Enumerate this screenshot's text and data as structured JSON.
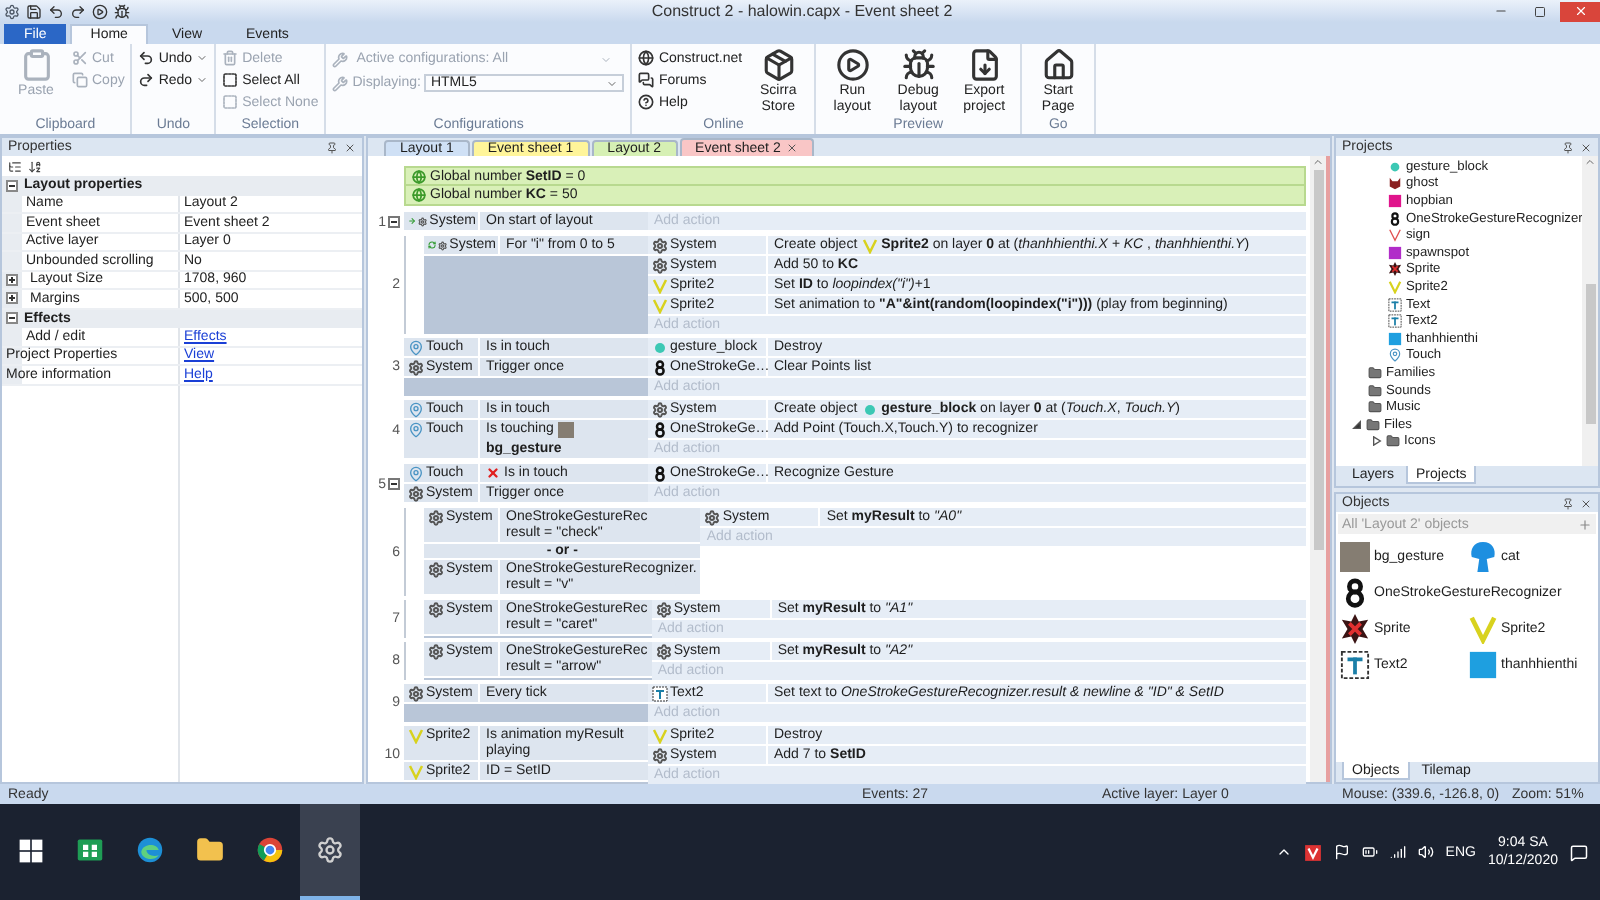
{
  "title_bar": {
    "title": "Construct 2 - halowin.capx - Event sheet 2"
  },
  "ribbon": {
    "tabs": [
      {
        "label": "File",
        "kind": "menu",
        "selected": false
      },
      {
        "label": "Home",
        "kind": "tab",
        "selected": true
      },
      {
        "label": "View",
        "kind": "tab",
        "selected": false
      },
      {
        "label": "Events",
        "kind": "tab",
        "selected": false
      }
    ],
    "groups": [
      {
        "label": "Clipboard",
        "items": [
          {
            "kind": "large",
            "label": "Paste",
            "disabled": true
          },
          {
            "kind": "small",
            "label": "Cut",
            "disabled": true
          },
          {
            "kind": "small",
            "label": "Copy",
            "disabled": true
          }
        ]
      },
      {
        "label": "Undo",
        "items": [
          {
            "kind": "split",
            "label": "Undo",
            "disabled": false
          },
          {
            "kind": "split",
            "label": "Redo",
            "disabled": false
          }
        ]
      },
      {
        "label": "Selection",
        "items": [
          {
            "kind": "small",
            "label": "Delete",
            "disabled": true
          },
          {
            "kind": "small",
            "label": "Select All",
            "disabled": false
          },
          {
            "kind": "small",
            "label": "Select None",
            "disabled": true
          }
        ]
      },
      {
        "label": "Configurations",
        "items": [
          {
            "kind": "combo",
            "label": "Active configurations: All",
            "disabled": true
          },
          {
            "kind": "combo",
            "label": "Displaying:",
            "value": "HTML5",
            "disabled": true
          }
        ]
      },
      {
        "label": "Online",
        "items": [
          {
            "kind": "small",
            "label": "Construct.net",
            "disabled": false
          },
          {
            "kind": "small",
            "label": "Forums",
            "disabled": false
          },
          {
            "kind": "small",
            "label": "Help",
            "disabled": false
          },
          {
            "kind": "large",
            "label": "Scirra Store",
            "disabled": false
          }
        ]
      },
      {
        "label": "Preview",
        "items": [
          {
            "kind": "large",
            "label": "Run layout",
            "disabled": false
          },
          {
            "kind": "large",
            "label": "Debug layout",
            "disabled": false
          },
          {
            "kind": "large",
            "label": "Export project",
            "disabled": false
          }
        ]
      },
      {
        "label": "Go",
        "items": [
          {
            "kind": "large",
            "label": "Start Page",
            "disabled": false
          }
        ]
      }
    ]
  },
  "properties": {
    "title": "Properties",
    "sections": [
      {
        "title": "Layout properties",
        "expanded": true,
        "rows": [
          {
            "name": "Name",
            "value": "Layout 2",
            "kind": "plain"
          },
          {
            "name": "Event sheet",
            "value": "Event sheet 2",
            "kind": "plain"
          },
          {
            "name": "Active layer",
            "value": "Layer 0",
            "kind": "plain"
          },
          {
            "name": "Unbounded scrolling",
            "value": "No",
            "kind": "plain"
          },
          {
            "name": "Layout Size",
            "value": "1708, 960",
            "kind": "group",
            "expanded": false
          },
          {
            "name": "Margins",
            "value": "500, 500",
            "kind": "group",
            "expanded": false
          }
        ]
      },
      {
        "title": "Effects",
        "expanded": true,
        "rows": [
          {
            "name": "Add / edit",
            "value": "Effects",
            "kind": "link"
          }
        ]
      }
    ],
    "rows": [
      {
        "name": "Project Properties",
        "value": "View",
        "kind": "link"
      },
      {
        "name": "More information",
        "value": "Help",
        "kind": "link"
      }
    ]
  },
  "doc_tabs": [
    {
      "label": "Layout 1",
      "color": "#cfe0f5",
      "selected": false
    },
    {
      "label": "Event sheet 1",
      "color": "#fff59a",
      "selected": false
    },
    {
      "label": "Layout 2",
      "color": "#d6f0b4",
      "selected": false
    },
    {
      "label": "Event sheet 2",
      "color": "#f9c6c6",
      "selected": true
    }
  ],
  "event_sheet": {
    "globals": [
      {
        "text": "Global number **SetID** = 0"
      },
      {
        "text": "Global number **KC** = 50"
      }
    ],
    "events": [
      {
        "number": "1",
        "expanded": true,
        "conditions": [
          {
            "object": "System",
            "kind": "system-start",
            "text": "On start of layout",
            "inverted": false
          }
        ],
        "add_action": "Add action",
        "children": [
          {
            "number": "2",
            "conditions": [
              {
                "object": "System",
                "kind": "system-loop",
                "text": "For \"i\" from 0 to 5",
                "inverted": false
              }
            ],
            "actions": [
              {
                "object": "System",
                "kind": "system-create-sprite2",
                "text": "Create object",
                "ref": "**Sprite2** on layer **0** at (*thanhhienthi.X + KC* , *thanhhienthi.Y*)"
              },
              {
                "object": "System",
                "kind": "system",
                "text": "Add 50 to **KC**"
              },
              {
                "object": "Sprite2",
                "kind": "sprite2",
                "text": "Set **ID** to *loopindex(\"i\")*+1"
              },
              {
                "object": "Sprite2",
                "kind": "sprite2",
                "text": "Set animation to **\"A\"&int(random(loopindex(\"i\")))** (play from beginning)"
              }
            ],
            "add_action": "Add action"
          }
        ]
      },
      {
        "number": "3",
        "conditions": [
          {
            "object": "Touch",
            "kind": "touch",
            "text": "Is in touch",
            "inverted": false
          },
          {
            "object": "System",
            "kind": "system",
            "text": "Trigger once",
            "inverted": false
          }
        ],
        "actions": [
          {
            "object": "gesture_block",
            "kind": "gesture",
            "text": "Destroy"
          },
          {
            "object": "OneStrokeGe…",
            "kind": "recognizer",
            "text": "Clear Points list"
          }
        ],
        "add_action": "Add action"
      },
      {
        "number": "4",
        "conditions": [
          {
            "object": "Touch",
            "kind": "touch",
            "text": "Is in touch",
            "inverted": false
          },
          {
            "object": "Touch",
            "kind": "touch-object",
            "text": "Is touching",
            "param": "bg_gesture",
            "inverted": false
          }
        ],
        "actions": [
          {
            "object": "System",
            "kind": "system-create-gesture",
            "text": "Create object",
            "ref": "**gesture_block** on layer **0** at (*Touch.X*, *Touch.Y*)"
          },
          {
            "object": "OneStrokeGe…",
            "kind": "recognizer",
            "text": "Add Point (Touch.X,Touch.Y) to recognizer"
          }
        ],
        "add_action": "Add action"
      },
      {
        "number": "5",
        "expanded": true,
        "conditions": [
          {
            "object": "Touch",
            "kind": "touch",
            "text": "Is in touch",
            "inverted": true
          },
          {
            "object": "System",
            "kind": "system",
            "text": "Trigger once",
            "inverted": false
          }
        ],
        "actions": [
          {
            "object": "OneStrokeGe…",
            "kind": "recognizer",
            "text": "Recognize Gesture"
          }
        ],
        "add_action": "Add action",
        "children": [
          {
            "number": "6",
            "or_label": "- or -",
            "conditions": [
              {
                "object": "System",
                "kind": "system",
                "text": "OneStrokeGestureRec\nresult = \"check\"",
                "inverted": false
              },
              {
                "object": "System",
                "kind": "system",
                "text": "OneStrokeGestureRecognizer.\nresult = \"v\"",
                "inverted": false
              }
            ],
            "actions": [
              {
                "object": "System",
                "kind": "system",
                "text": "Set **myResult** to *\"A0\"*"
              }
            ],
            "add_action": "Add action"
          },
          {
            "number": "7",
            "conditions": [
              {
                "object": "System",
                "kind": "system",
                "text": "OneStrokeGestureRec\nresult = \"caret\"",
                "inverted": false
              }
            ],
            "actions": [
              {
                "object": "System",
                "kind": "system",
                "text": "Set **myResult** to *\"A1\"*"
              }
            ],
            "add_action": "Add action"
          },
          {
            "number": "8",
            "conditions": [
              {
                "object": "System",
                "kind": "system",
                "text": "OneStrokeGestureRec\nresult = \"arrow\"",
                "inverted": false
              }
            ],
            "actions": [
              {
                "object": "System",
                "kind": "system",
                "text": "Set **myResult** to *\"A2\"*"
              }
            ],
            "add_action": "Add action"
          }
        ]
      },
      {
        "number": "9",
        "conditions": [
          {
            "object": "System",
            "kind": "system",
            "text": "Every tick",
            "inverted": false
          }
        ],
        "actions": [
          {
            "object": "Text2",
            "kind": "text",
            "text": "Set text to *OneStrokeGestureRecognizer.result & newline & \"ID\" & SetID*"
          }
        ],
        "add_action": "Add action"
      },
      {
        "number": "10",
        "conditions": [
          {
            "object": "Sprite2",
            "kind": "sprite2",
            "text": "Is animation myResult\nplaying",
            "inverted": false
          },
          {
            "object": "Sprite2",
            "kind": "sprite2",
            "text": "ID = SetID",
            "inverted": false
          }
        ],
        "actions": [
          {
            "object": "Sprite2",
            "kind": "sprite2",
            "text": "Destroy"
          },
          {
            "object": "System",
            "kind": "system",
            "text": "Add 7 to **SetID**"
          }
        ],
        "add_action": "Add action"
      }
    ]
  },
  "projects": {
    "title": "Projects",
    "objects": [
      {
        "label": "gesture_block",
        "kind": "gesture"
      },
      {
        "label": "ghost",
        "kind": "ghost"
      },
      {
        "label": "hopbian",
        "kind": "pink-square"
      },
      {
        "label": "OneStrokeGestureRecognizer",
        "kind": "recognizer"
      },
      {
        "label": "sign",
        "kind": "sign"
      },
      {
        "label": "spawnspot",
        "kind": "purple-square"
      },
      {
        "label": "Sprite",
        "kind": "sprite"
      },
      {
        "label": "Sprite2",
        "kind": "sprite2"
      },
      {
        "label": "Text",
        "kind": "text"
      },
      {
        "label": "Text2",
        "kind": "text"
      },
      {
        "label": "thanhhienthi",
        "kind": "blue-square"
      },
      {
        "label": "Touch",
        "kind": "touch"
      }
    ],
    "folders": [
      {
        "label": "Families"
      },
      {
        "label": "Sounds"
      },
      {
        "label": "Music"
      },
      {
        "label": "Files",
        "expanded": true,
        "children": [
          {
            "label": "Icons",
            "expanded": false
          }
        ]
      }
    ],
    "tabs": [
      {
        "label": "Layers",
        "selected": false
      },
      {
        "label": "Projects",
        "selected": true
      }
    ]
  },
  "objects": {
    "title": "Objects",
    "filter": {
      "placeholder": "All 'Layout 2' objects"
    },
    "items": [
      {
        "label": "bg_gesture",
        "kind": "swatch"
      },
      {
        "label": "cat",
        "kind": "cat"
      },
      {
        "label": "OneStrokeGestureRecognizer",
        "kind": "recognizer"
      },
      {
        "label": "Sprite",
        "kind": "sprite"
      },
      {
        "label": "Sprite2",
        "kind": "sprite2"
      },
      {
        "label": "Text2",
        "kind": "text"
      },
      {
        "label": "thanhhienthi",
        "kind": "blue-square"
      }
    ],
    "tabs": [
      {
        "label": "Objects",
        "selected": true
      },
      {
        "label": "Tilemap",
        "selected": false
      }
    ]
  },
  "status_bar": {
    "message": "Ready",
    "events": "Events: 27",
    "layer": "Active layer: Layer 0",
    "mouse": "Mouse: (339.6, -126.8, 0)",
    "zoom": "Zoom: 51%"
  },
  "taskbar": {
    "apps": [
      {
        "kind": "store",
        "active": false
      },
      {
        "kind": "edge",
        "active": false
      },
      {
        "kind": "folder",
        "active": false
      },
      {
        "kind": "chrome",
        "active": false
      },
      {
        "kind": "construct",
        "active": true
      }
    ],
    "language": "ENG",
    "time": "9:04 SA",
    "date": "10/12/2020"
  }
}
